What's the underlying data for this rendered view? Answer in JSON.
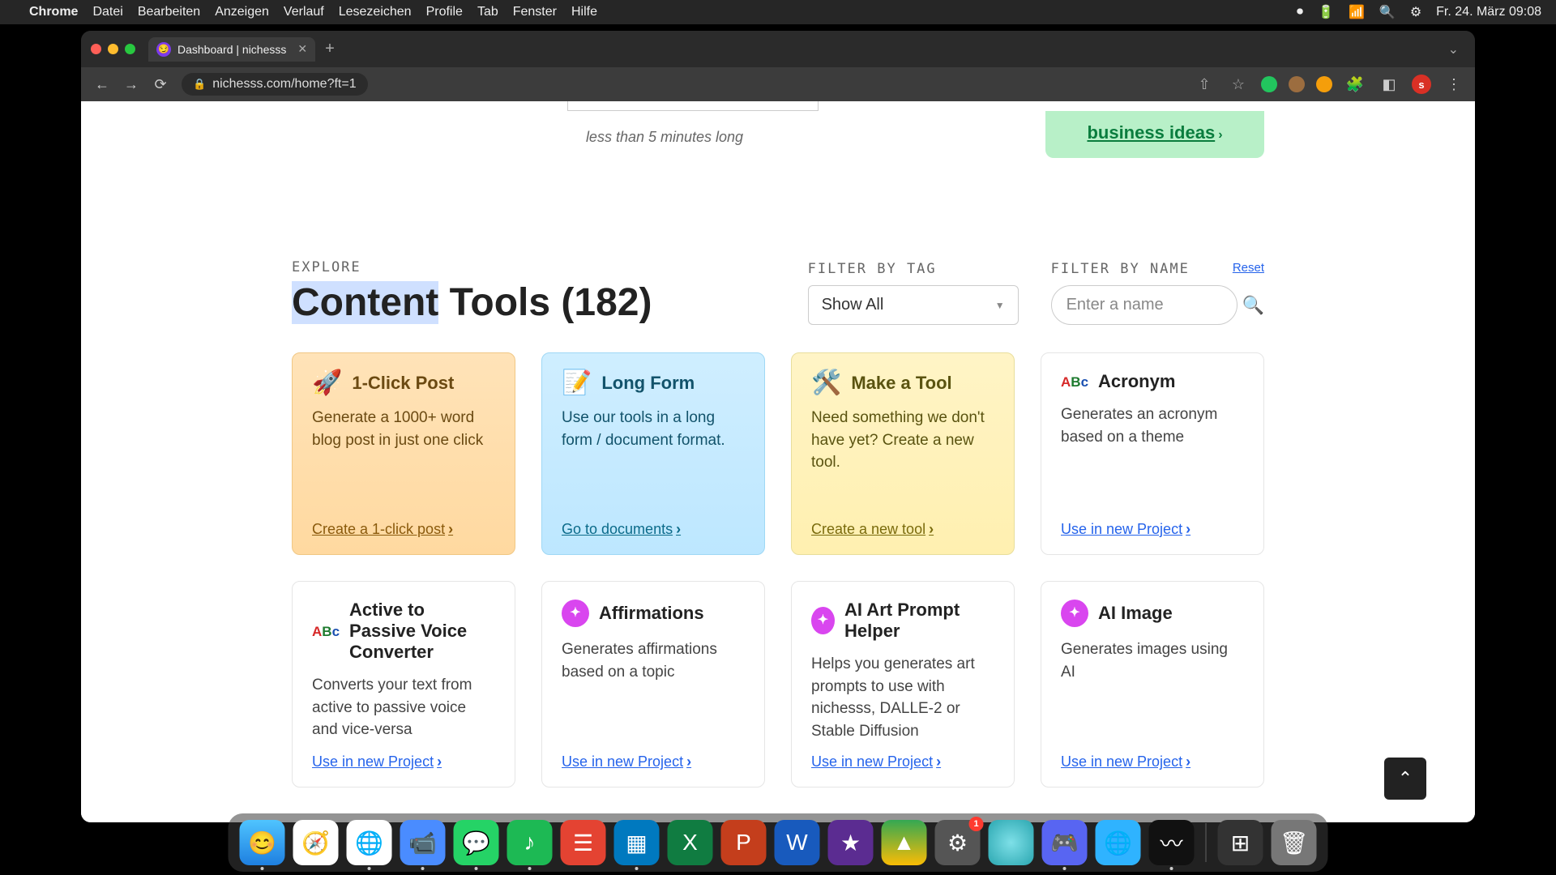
{
  "menubar": {
    "app": "Chrome",
    "items": [
      "Datei",
      "Bearbeiten",
      "Anzeigen",
      "Verlauf",
      "Lesezeichen",
      "Profile",
      "Tab",
      "Fenster",
      "Hilfe"
    ],
    "clock": "Fr. 24. März 09:08"
  },
  "tab": {
    "title": "Dashboard | nichesss",
    "favicon": "😏"
  },
  "url": "nichesss.com/home?ft=1",
  "profile_initial": "s",
  "video_caption": "less than 5 minutes long",
  "biz_link": "business ideas",
  "explore_label": "EXPLORE",
  "page_title_pre": "Content",
  "page_title_post": " Tools (182)",
  "filter_tag": {
    "label": "FILTER BY TAG",
    "value": "Show All"
  },
  "filter_name": {
    "label": "FILTER BY NAME",
    "placeholder": "Enter a name",
    "reset": "Reset"
  },
  "cards": [
    {
      "icon": "🚀",
      "title": "1-Click Post",
      "desc": "Generate a 1000+ word blog post in just one click",
      "link": "Create a 1-click post",
      "cls": "orange"
    },
    {
      "icon": "📝",
      "title": "Long Form",
      "desc": "Use our tools in a long form / document format.",
      "link": "Go to documents",
      "cls": "blue"
    },
    {
      "icon": "🛠️",
      "title": "Make a Tool",
      "desc": "Need something we don't have yet? Create a new tool.",
      "link": "Create a new tool",
      "cls": "yellow"
    },
    {
      "icon": "abc",
      "title": "Acronym",
      "desc": "Generates an acronym based on a theme",
      "link": "Use in new Project",
      "cls": ""
    },
    {
      "icon": "abc",
      "title": "Active to Passive Voice Converter",
      "desc": "Converts your text from active to passive voice and vice-versa",
      "link": "Use in new Project",
      "cls": ""
    },
    {
      "icon": "badge",
      "title": "Affirmations",
      "desc": "Generates affirmations based on a topic",
      "link": "Use in new Project",
      "cls": ""
    },
    {
      "icon": "badge",
      "title": "AI Art Prompt Helper",
      "desc": "Helps you generates art prompts to use with nichesss, DALLE-2 or Stable Diffusion",
      "link": "Use in new Project",
      "cls": ""
    },
    {
      "icon": "badge",
      "title": "AI Image",
      "desc": "Generates images using AI",
      "link": "Use in new Project",
      "cls": ""
    }
  ],
  "dock": {
    "badge_settings": "1",
    "apps": [
      "Finder",
      "Safari",
      "Chrome",
      "Zoom",
      "WhatsApp",
      "Spotify",
      "Todoist",
      "Trello",
      "Excel",
      "PowerPoint",
      "Word",
      "iMovie",
      "Drive",
      "Settings",
      "Siri",
      "Discord",
      "Browser2",
      "Voice",
      "Blank",
      "MissionControl",
      "Trash"
    ]
  }
}
